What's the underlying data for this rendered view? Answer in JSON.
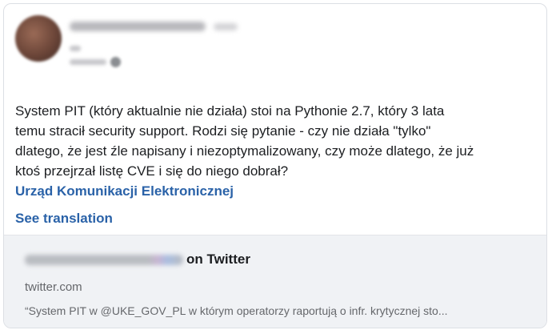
{
  "post": {
    "text": "System PIT (który aktualnie nie działa) stoi na Pythonie 2.7, który 3 lata\ntemu stracił security support. Rodzi się pytanie - czy nie działa \"tylko\"\ndlatego, że jest źle napisany i niezoptymalizowany, czy może dlatego, że już\nktoś przejrzał listę CVE i się do niego dobrał?",
    "mention": "Urząd Komunikacji Elektronicznej",
    "see_translation": "See translation"
  },
  "link_preview": {
    "title_suffix": "on Twitter",
    "domain": "twitter.com",
    "description": "“System PIT w @UKE_GOV_PL w którym operatorzy raportują o infr. krytycznej sto..."
  },
  "colors": {
    "link": "#2a62a8",
    "text": "#1c1e21",
    "muted": "#65676b",
    "preview_bg": "#f0f2f5"
  }
}
